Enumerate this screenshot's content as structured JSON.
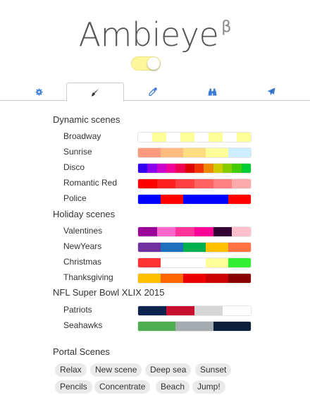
{
  "app": {
    "title": "Ambieye",
    "superscript": "β",
    "power_toggle": "on",
    "toggle_color": "#fff59a"
  },
  "tabs": [
    {
      "icon": "gear-icon",
      "active": false
    },
    {
      "icon": "paintbrush-icon",
      "active": true
    },
    {
      "icon": "eyedropper-icon",
      "active": false
    },
    {
      "icon": "binoculars-icon",
      "active": false
    },
    {
      "icon": "paper-plane-icon",
      "active": false
    }
  ],
  "accent_color": "#3a7bd5",
  "sections": [
    {
      "title": "Dynamic scenes",
      "scenes": [
        {
          "name": "Broadway",
          "colors": [
            "#ffffff",
            "#ffff99",
            "#ffffff",
            "#ffff99",
            "#ffffff",
            "#ffff99",
            "#ffffff",
            "#ffff99"
          ]
        },
        {
          "name": "Sunrise",
          "colors": [
            "#ff9980",
            "#ffbb80",
            "#ffdd80",
            "#ffff99",
            "#cceeff"
          ]
        },
        {
          "name": "Disco",
          "colors": [
            "#3300ee",
            "#8800ee",
            "#cc00cc",
            "#ee0099",
            "#ee0055",
            "#dd0000",
            "#ee3300",
            "#ee8800",
            "#cccc00",
            "#88cc00",
            "#44cc00",
            "#00cc33"
          ]
        },
        {
          "name": "Romantic Red",
          "colors": [
            "#ff0000",
            "#ff2020",
            "#ff4040",
            "#ff6060",
            "#ff8080",
            "#ffaaaa"
          ]
        },
        {
          "name": "Police",
          "colors": [
            "#0000ff",
            "#ff0000",
            "#0000ff",
            "#0000ff",
            "#ff0000"
          ]
        }
      ]
    },
    {
      "title": "Holiday scenes",
      "scenes": [
        {
          "name": "Valentines",
          "colors": [
            "#990099",
            "#ff66cc",
            "#ff3399",
            "#ff0099",
            "#330033",
            "#ffc0cb"
          ]
        },
        {
          "name": "NewYears",
          "colors": [
            "#7030a0",
            "#1f6fbf",
            "#00b050",
            "#ffc000",
            "#ff7043"
          ]
        },
        {
          "name": "Christmas",
          "colors": [
            "#ff3333",
            "#ffffff",
            "#ffffff",
            "#ffff99",
            "#33ee33"
          ]
        },
        {
          "name": "Thanksgiving",
          "colors": [
            "#ffc000",
            "#ff6600",
            "#ee0000",
            "#cc0000",
            "#880000"
          ]
        }
      ]
    },
    {
      "title": "NFL Super Bowl XLIX 2015",
      "scenes": [
        {
          "name": "Patriots",
          "colors": [
            "#0d2451",
            "#c8102e",
            "#d6d6d6",
            "#ffffff"
          ]
        },
        {
          "name": "Seahawks",
          "colors": [
            "#4caf50",
            "#a5acaf",
            "#0b1e3a"
          ]
        }
      ]
    }
  ],
  "portal": {
    "title": "Portal Scenes",
    "items": [
      "Relax",
      "New scene",
      "Deep sea",
      "Sunset",
      "Pencils",
      "Concentrate",
      "Beach",
      "Jump!"
    ]
  }
}
